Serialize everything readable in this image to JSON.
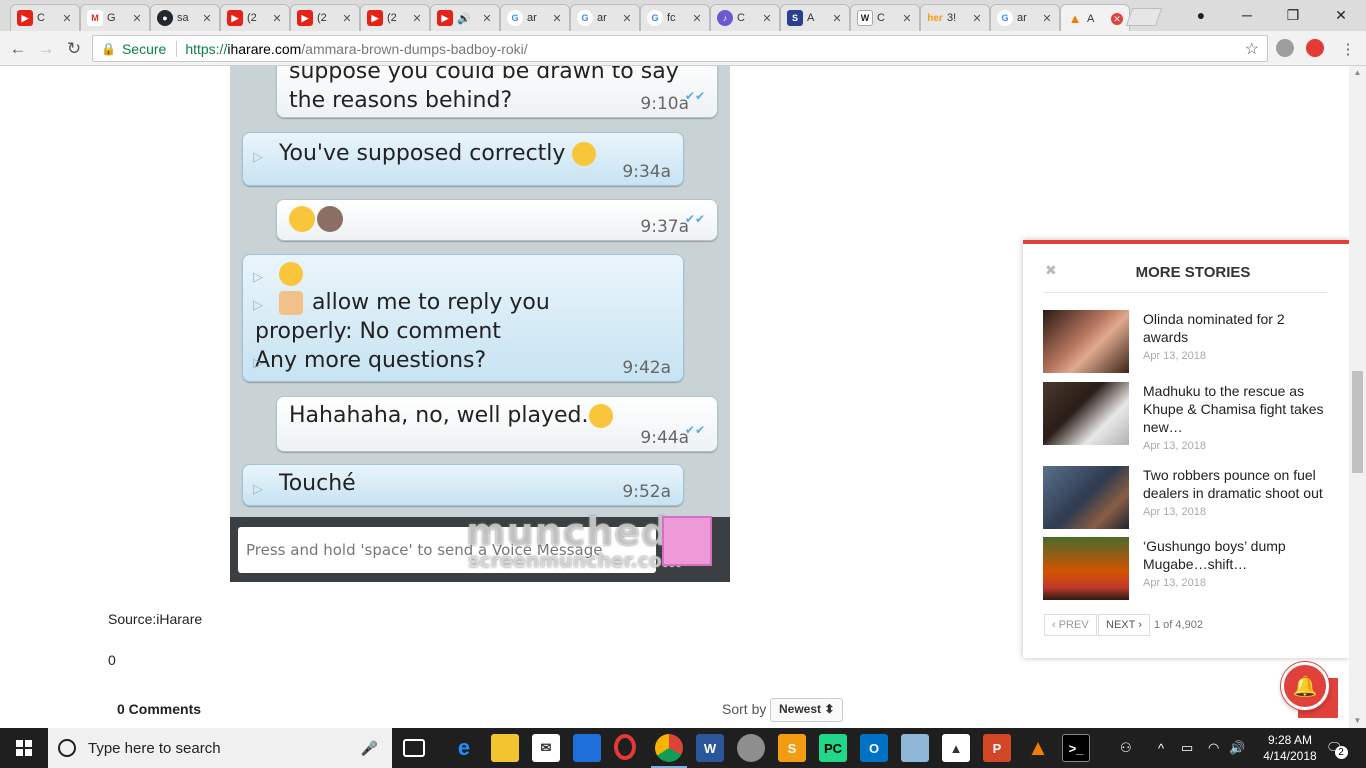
{
  "browser": {
    "tabs": [
      {
        "title": "C",
        "icon": "youtube-icon",
        "color": "#e62117"
      },
      {
        "title": "G",
        "icon": "gmail-icon",
        "color": "#d93025"
      },
      {
        "title": "sa",
        "icon": "github-icon",
        "color": "#24292e"
      },
      {
        "title": "(2",
        "icon": "youtube-icon",
        "color": "#e62117"
      },
      {
        "title": "(2",
        "icon": "youtube-icon",
        "color": "#e62117"
      },
      {
        "title": "(2",
        "icon": "youtube-icon",
        "color": "#e62117"
      },
      {
        "title": "🔊",
        "icon": "youtube-icon",
        "color": "#e62117"
      },
      {
        "title": "ar",
        "icon": "google-icon",
        "color": "#4285f4"
      },
      {
        "title": "ar",
        "icon": "google-icon",
        "color": "#4285f4"
      },
      {
        "title": "fc",
        "icon": "google-icon",
        "color": "#4285f4"
      },
      {
        "title": "C",
        "icon": "guitar-icon",
        "color": "#6a5acd"
      },
      {
        "title": "A",
        "icon": "s-icon",
        "color": "#2c3e8f"
      },
      {
        "title": "C",
        "icon": "wikipedia-icon",
        "color": "#444"
      },
      {
        "title": "3!",
        "icon": "her-icon",
        "color": "#f39c12"
      },
      {
        "title": "ar",
        "icon": "google-icon",
        "color": "#4285f4"
      },
      {
        "title": "A",
        "icon": "fire-icon",
        "color": "#f57c00"
      }
    ],
    "address": {
      "secure_label": "Secure",
      "url_scheme": "https://",
      "url_host": "iharare.com",
      "url_path": "/ammara-brown-dumps-badboy-roki/"
    }
  },
  "chat": {
    "messages": [
      {
        "side": "out",
        "text_line1": "suppose you could be drawn to say",
        "text_line2": "the reasons behind?",
        "time": "9:10a"
      },
      {
        "side": "in",
        "text": "You've supposed correctly",
        "time": "9:34a"
      },
      {
        "side": "out",
        "text": "",
        "time": "9:37a"
      },
      {
        "side": "in",
        "line2": "allow me to reply you",
        "line3": "properly: No comment",
        "line4": "Any more questions?",
        "time": "9:42a"
      },
      {
        "side": "out",
        "text": "Hahahaha, no, well played.",
        "time": "9:44a"
      },
      {
        "side": "in",
        "text": "Touché",
        "time": "9:52a"
      }
    ],
    "input_placeholder": "Press and hold 'space' to send a Voice Message",
    "watermark": "munched",
    "watermark_sub": "screenmuncher.com"
  },
  "article": {
    "source": "Source:iHarare",
    "count": "0"
  },
  "comments": {
    "count_label": "0 Comments",
    "sort_label": "Sort by",
    "sort_value": "Newest ⬍"
  },
  "more_stories": {
    "title": "MORE STORIES",
    "stories": [
      {
        "title": "Olinda nominated for 2 awards",
        "date": "Apr 13, 2018"
      },
      {
        "title": "Madhuku to the rescue as Khupe & Chamisa fight takes new…",
        "date": "Apr 13, 2018"
      },
      {
        "title": "Two robbers pounce on fuel dealers in dramatic shoot out",
        "date": "Apr 13, 2018"
      },
      {
        "title": "‘Gushungo boys’ dump Mugabe…shift…",
        "date": "Apr 13, 2018"
      }
    ],
    "prev_label": "‹ PREV",
    "next_label": "NEXT ›",
    "page_info": "1 of 4,902"
  },
  "taskbar": {
    "search_placeholder": "Type here to search",
    "time": "9:28 AM",
    "date": "4/14/2018",
    "notification_count": "2"
  },
  "colors": {
    "accent": "#e0413a",
    "secure": "#0b8043"
  }
}
